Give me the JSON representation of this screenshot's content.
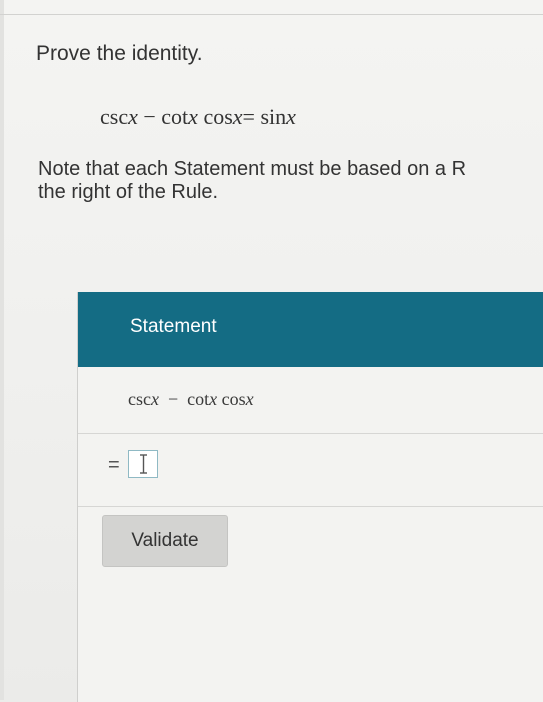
{
  "problem": {
    "prompt": "Prove the identity.",
    "identity": {
      "term1_fn": "csc",
      "term1_var": "x",
      "minus": "−",
      "term2_fn": "cot",
      "term2_var": "x",
      "term3_fn": "cos",
      "term3_var": "x",
      "equals": "=",
      "rhs_fn": "sin",
      "rhs_var": "x"
    },
    "note_line1": "Note that each Statement must be based on a R",
    "note_line2": "the right of the Rule."
  },
  "table": {
    "header": "Statement",
    "statement_row": {
      "t1": "csc",
      "v1": "x",
      "minus": "−",
      "t2": "cot",
      "v2": "x",
      "t3": "cos",
      "v3": "x"
    },
    "answer_row": {
      "equals": "=",
      "input_value": ""
    },
    "validate_label": "Validate"
  },
  "colors": {
    "header_bg": "#146c84",
    "input_border": "#8fb9c4"
  }
}
